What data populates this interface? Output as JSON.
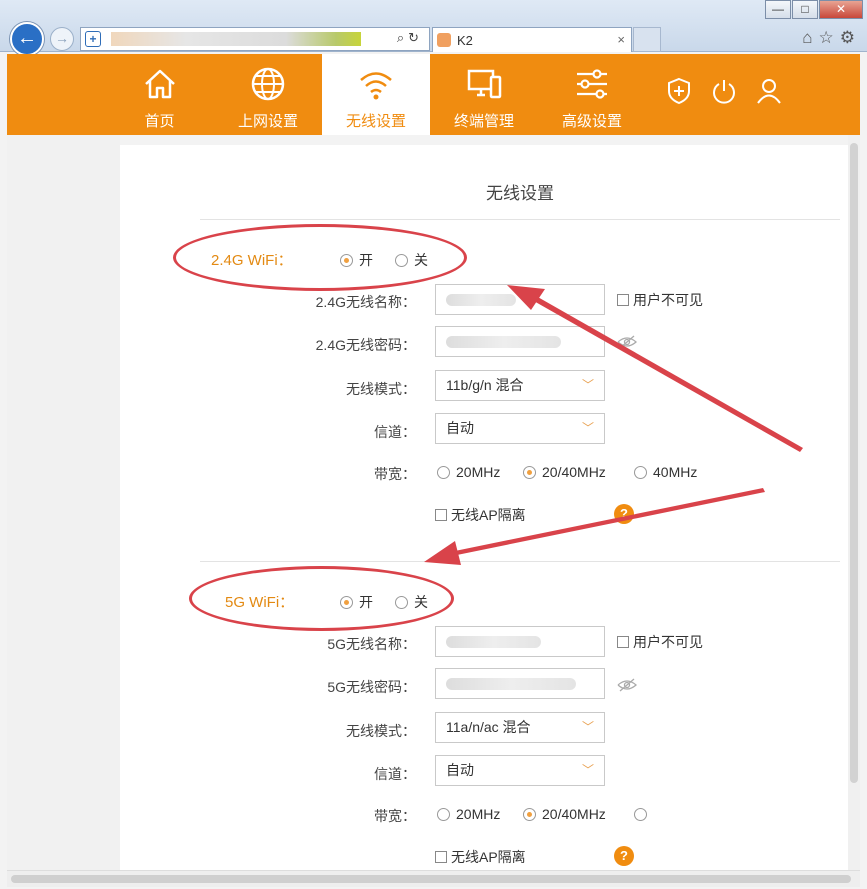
{
  "browser": {
    "tab_title": "K2",
    "tab_close": "×",
    "window_buttons": {
      "minimize": "—",
      "maximize": "□",
      "close": "✕"
    }
  },
  "nav": {
    "items": [
      {
        "label": "首页",
        "icon": "home-icon"
      },
      {
        "label": "上网设置",
        "icon": "globe-icon"
      },
      {
        "label": "无线设置",
        "icon": "wifi-icon",
        "active": true
      },
      {
        "label": "终端管理",
        "icon": "devices-icon"
      },
      {
        "label": "高级设置",
        "icon": "sliders-icon"
      }
    ],
    "accent": "#f08c10"
  },
  "page": {
    "title": "无线设置"
  },
  "wifi24": {
    "section": "2.4G WiFi：",
    "on": "开",
    "off": "关",
    "enabled": true,
    "name_label": "2.4G无线名称：",
    "password_label": "2.4G无线密码：",
    "hidden_label": "用户不可见",
    "mode_label": "无线模式：",
    "mode_value": "11b/g/n 混合",
    "channel_label": "信道：",
    "channel_value": "自动",
    "bandwidth_label": "带宽：",
    "bw_options": [
      "20MHz",
      "20/40MHz",
      "40MHz"
    ],
    "bw_selected": "20/40MHz",
    "ap_isolation_label": "无线AP隔离",
    "help": "?"
  },
  "wifi5": {
    "section": "5G WiFi：",
    "on": "开",
    "off": "关",
    "enabled": true,
    "name_label": "5G无线名称：",
    "password_label": "5G无线密码：",
    "hidden_label": "用户不可见",
    "mode_label": "无线模式：",
    "mode_value": "11a/n/ac 混合",
    "channel_label": "信道：",
    "channel_value": "自动",
    "bandwidth_label": "带宽：",
    "bw_options": [
      "20MHz",
      "20/40MHz"
    ],
    "bw_selected": "20/40MHz",
    "ap_isolation_label": "无线AP隔离",
    "help": "?"
  },
  "colors": {
    "annotation": "#d9434a",
    "section_text": "#e38a13"
  }
}
